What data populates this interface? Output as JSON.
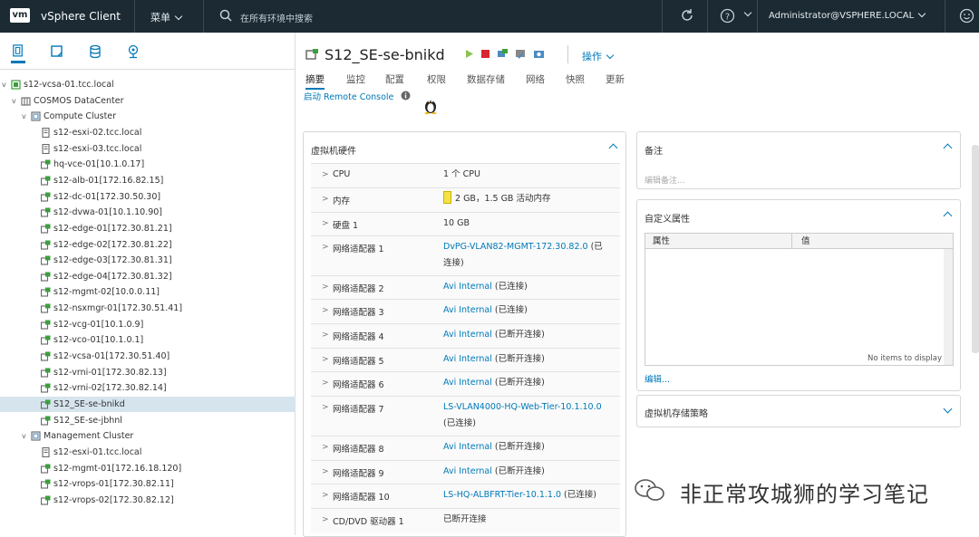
{
  "app": {
    "logo": "vm",
    "name": "vSphere Client",
    "menu_label": "菜单",
    "search_placeholder": "在所有环境中搜索",
    "user": "Administrator@VSPHERE.LOCAL"
  },
  "left": {
    "tab_icons": [
      "hosts-clusters-icon",
      "vms-templates-icon",
      "storage-icon",
      "networking-icon"
    ],
    "tree": [
      {
        "label": "s12-vcsa-01.tcc.local",
        "icon": "vcenter-icon",
        "expanded": true
      },
      {
        "label": "COSMOS DataCenter",
        "icon": "datacenter-icon",
        "expanded": true
      },
      {
        "label": "Compute Cluster",
        "icon": "cluster-icon",
        "expanded": true
      },
      {
        "label": "s12-esxi-02.tcc.local",
        "icon": "host-icon"
      },
      {
        "label": "s12-esxi-03.tcc.local",
        "icon": "host-icon"
      },
      {
        "label": "hq-vce-01[10.1.0.17]",
        "icon": "vm-icon"
      },
      {
        "label": "s12-alb-01[172.16.82.15]",
        "icon": "vm-icon"
      },
      {
        "label": "s12-dc-01[172.30.50.30]",
        "icon": "vm-icon"
      },
      {
        "label": "s12-dvwa-01[10.1.10.90]",
        "icon": "vm-icon"
      },
      {
        "label": "s12-edge-01[172.30.81.21]",
        "icon": "vm-icon"
      },
      {
        "label": "s12-edge-02[172.30.81.22]",
        "icon": "vm-icon"
      },
      {
        "label": "s12-edge-03[172.30.81.31]",
        "icon": "vm-icon"
      },
      {
        "label": "s12-edge-04[172.30.81.32]",
        "icon": "vm-icon"
      },
      {
        "label": "s12-mgmt-02[10.0.0.11]",
        "icon": "vm-icon"
      },
      {
        "label": "s12-nsxmgr-01[172.30.51.41]",
        "icon": "vm-icon"
      },
      {
        "label": "s12-vcg-01[10.1.0.9]",
        "icon": "vm-icon"
      },
      {
        "label": "s12-vco-01[10.1.0.1]",
        "icon": "vm-icon"
      },
      {
        "label": "s12-vcsa-01[172.30.51.40]",
        "icon": "vm-icon"
      },
      {
        "label": "s12-vrni-01[172.30.82.13]",
        "icon": "vm-icon"
      },
      {
        "label": "s12-vrni-02[172.30.82.14]",
        "icon": "vm-icon"
      },
      {
        "label": "S12_SE-se-bnikd",
        "icon": "vm-icon",
        "selected": true
      },
      {
        "label": "S12_SE-se-jbhnl",
        "icon": "vm-icon"
      },
      {
        "label": "Management Cluster",
        "icon": "cluster-icon",
        "expanded": true
      },
      {
        "label": "s12-esxi-01.tcc.local",
        "icon": "host-icon"
      },
      {
        "label": "s12-mgmt-01[172.16.18.120]",
        "icon": "vm-icon"
      },
      {
        "label": "s12-vrops-01[172.30.82.11]",
        "icon": "vm-icon"
      },
      {
        "label": "s12-vrops-02[172.30.82.12]",
        "icon": "vm-icon"
      }
    ]
  },
  "main": {
    "vm_title": "S12_SE-se-bnikd",
    "actions_label": "操作",
    "tabs": [
      "摘要",
      "监控",
      "配置",
      "权限",
      "数据存储",
      "网络",
      "快照",
      "更新"
    ],
    "remote_console": "启动 Remote Console",
    "hardware": {
      "title": "虚拟机硬件",
      "rows": [
        {
          "key": "CPU",
          "value": "1 个 CPU",
          "link": false
        },
        {
          "key": "内存",
          "value": "2 GB，1.5 GB 活动内存",
          "link": false,
          "icon": "memory-icon"
        },
        {
          "key": "硬盘 1",
          "value": "10 GB",
          "link": false
        },
        {
          "key": "网络适配器 1",
          "value": "DvPG-VLAN82-MGMT-172.30.82.0",
          "suffix": " (已连接)",
          "link": true
        },
        {
          "key": "网络适配器 2",
          "value": "Avi Internal",
          "suffix": " (已连接)",
          "link": true
        },
        {
          "key": "网络适配器 3",
          "value": "Avi Internal",
          "suffix": " (已连接)",
          "link": true
        },
        {
          "key": "网络适配器 4",
          "value": "Avi Internal",
          "suffix": " (已断开连接)",
          "link": true
        },
        {
          "key": "网络适配器 5",
          "value": "Avi Internal",
          "suffix": " (已断开连接)",
          "link": true
        },
        {
          "key": "网络适配器 6",
          "value": "Avi Internal",
          "suffix": " (已断开连接)",
          "link": true
        },
        {
          "key": "网络适配器 7",
          "value": "LS-VLAN4000-HQ-Web-Tier-10.1.10.0",
          "suffix": " (已连接)",
          "link": true
        },
        {
          "key": "网络适配器 8",
          "value": "Avi Internal",
          "suffix": " (已断开连接)",
          "link": true
        },
        {
          "key": "网络适配器 9",
          "value": "Avi Internal",
          "suffix": " (已断开连接)",
          "link": true
        },
        {
          "key": "网络适配器 10",
          "value": "LS-HQ-ALBFRT-Tier-10.1.1.0",
          "suffix": " (已连接)",
          "link": true
        },
        {
          "key": "CD/DVD 驱动器 1",
          "value": "已断开连接",
          "link": false
        }
      ]
    },
    "notes": {
      "title": "备注",
      "placeholder": "编辑备注..."
    },
    "custom_attrs": {
      "title": "自定义属性",
      "col_attr": "属性",
      "col_value": "值",
      "empty": "No items to display",
      "edit": "编辑..."
    },
    "storage_policy": {
      "title": "虚拟机存储策略"
    }
  },
  "watermark": "非正常攻城狮的学习笔记"
}
